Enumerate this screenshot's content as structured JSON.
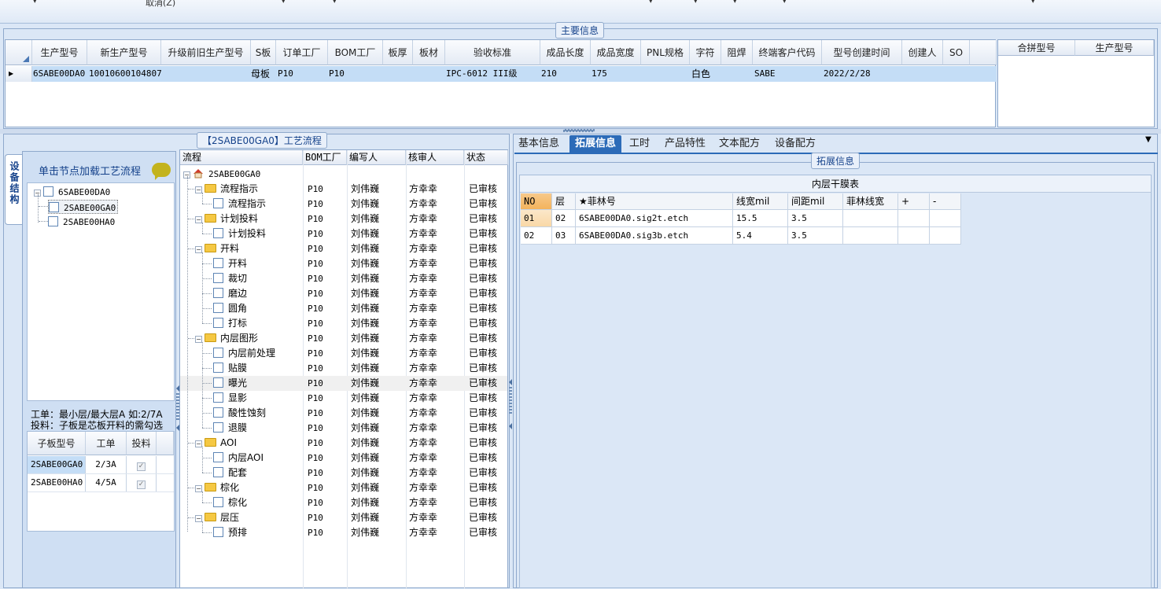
{
  "top": {
    "cancel_label": "取消(Z)"
  },
  "main_info": {
    "title": "主要信息",
    "columns": [
      "生产型号",
      "新生产型号",
      "升级前旧生产型号",
      "S板",
      "订单工厂",
      "BOM工厂",
      "板厚",
      "板材",
      "验收标准",
      "成品长度",
      "成品宽度",
      "PNL规格",
      "字符",
      "阻焊",
      "终端客户代码",
      "型号创建时间",
      "创建人",
      "SO"
    ],
    "row": {
      "model": "6SABE00DA0",
      "new_model": "10010600104807",
      "old_model": "",
      "s_board": "母板",
      "order_factory": "P10",
      "bom_factory": "P10",
      "thickness": "",
      "material": "",
      "standard": "IPC-6012 III级",
      "length": "210",
      "width": "175",
      "pnl": "",
      "char": "白色",
      "mask": "",
      "customer": "SABE",
      "created": "2022/2/28",
      "creator": "",
      "so": ""
    },
    "merge_columns": [
      "合拼型号",
      "生产型号"
    ]
  },
  "left_panel": {
    "vtab_label": "设备结构",
    "hint": "单击节点加载工艺流程",
    "tree": [
      {
        "label": "6SABE00DA0"
      },
      {
        "label": "2SABE00GA0"
      },
      {
        "label": "2SABE00HA0"
      }
    ],
    "note1": "工单：最小层/最大层A 如:2/7A",
    "note2": "投料：子板是芯板开料的需勾选",
    "sub_columns": [
      "子板型号",
      "工单",
      "投料"
    ],
    "sub_rows": [
      {
        "model": "2SABE00GA0",
        "order": "2/3A",
        "check": "✓"
      },
      {
        "model": "2SABE00HA0",
        "order": "4/5A",
        "check": "✓"
      }
    ]
  },
  "flow": {
    "title": "【2SABE00GA0】工艺流程",
    "columns": [
      "流程",
      "BOM工厂",
      "编写人",
      "核审人",
      "状态"
    ],
    "root": "2SABE00GA0",
    "rows": [
      {
        "name": "流程指示",
        "level": 1,
        "folder": true
      },
      {
        "name": "流程指示",
        "level": 2
      },
      {
        "name": "计划投料",
        "level": 1,
        "folder": true
      },
      {
        "name": "计划投料",
        "level": 2
      },
      {
        "name": "开料",
        "level": 1,
        "folder": true
      },
      {
        "name": "开料",
        "level": 2
      },
      {
        "name": "裁切",
        "level": 2
      },
      {
        "name": "磨边",
        "level": 2
      },
      {
        "name": "圆角",
        "level": 2
      },
      {
        "name": "打标",
        "level": 2
      },
      {
        "name": "内层图形",
        "level": 1,
        "folder": true
      },
      {
        "name": "内层前处理",
        "level": 2
      },
      {
        "name": "贴膜",
        "level": 2
      },
      {
        "name": "曝光",
        "level": 2,
        "selected": true
      },
      {
        "name": "显影",
        "level": 2
      },
      {
        "name": "酸性蚀刻",
        "level": 2
      },
      {
        "name": "退膜",
        "level": 2
      },
      {
        "name": "AOI",
        "level": 1,
        "folder": true
      },
      {
        "name": "内层AOI",
        "level": 2
      },
      {
        "name": "配套",
        "level": 2
      },
      {
        "name": "棕化",
        "level": 1,
        "folder": true
      },
      {
        "name": "棕化",
        "level": 2
      },
      {
        "name": "层压",
        "level": 1,
        "folder": true
      },
      {
        "name": "预排",
        "level": 2
      }
    ],
    "bom_factory": "P10",
    "writer": "刘伟巍",
    "reviewer": "方幸幸",
    "status": "已审核"
  },
  "right": {
    "tabs": [
      "基本信息",
      "拓展信息",
      "工时",
      "产品特性",
      "文本配方",
      "设备配方"
    ],
    "group_title": "拓展信息",
    "table_title": "内层干膜表",
    "columns": [
      "NO",
      "层",
      "★菲林号",
      "线宽mil",
      "间距mil",
      "菲林线宽",
      "+",
      "-"
    ],
    "rows": [
      {
        "no": "01",
        "layer": "02",
        "film": "6SABE00DA0.sig2t.etch",
        "width": "15.5",
        "spacing": "3.5",
        "film_width": ""
      },
      {
        "no": "02",
        "layer": "03",
        "film": "6SABE00DA0.sig3b.etch",
        "width": "5.4",
        "spacing": "3.5",
        "film_width": ""
      }
    ]
  }
}
